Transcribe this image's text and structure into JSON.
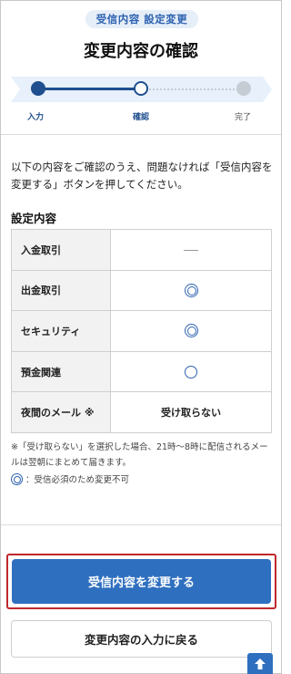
{
  "header": {
    "badge": "受信内容 設定変更",
    "title": "変更内容の確認"
  },
  "stepper": {
    "steps": [
      {
        "label": "入力",
        "state": "done"
      },
      {
        "label": "確認",
        "state": "current"
      },
      {
        "label": "完了",
        "state": "todo"
      }
    ]
  },
  "intro": "以下の内容をご確認のうえ、問題なければ「受信内容を変更する」ボタンを押してください。",
  "settings": {
    "section_title": "設定内容",
    "rows": [
      {
        "label": "入金取引",
        "value": "—",
        "icon": "dash-icon"
      },
      {
        "label": "出金取引",
        "value": "",
        "icon": "double-circle-icon"
      },
      {
        "label": "セキュリティ",
        "value": "",
        "icon": "double-circle-icon"
      },
      {
        "label": "預金関連",
        "value": "",
        "icon": "circle-icon"
      },
      {
        "label": "夜間のメール ※",
        "value": "受け取らない",
        "icon": ""
      }
    ]
  },
  "notes": {
    "night_note": "※「受け取らない」を選択した場合、21時〜8時に配信されるメールは翌朝にまとめて届きます。",
    "legend_note": "：受信必須のため変更不可"
  },
  "buttons": {
    "primary": "受信内容を変更する",
    "secondary": "変更内容の入力に戻る"
  },
  "colors": {
    "accent": "#2f6fbf",
    "highlight_border": "#c0272d",
    "step_active": "#1f4f8e"
  }
}
